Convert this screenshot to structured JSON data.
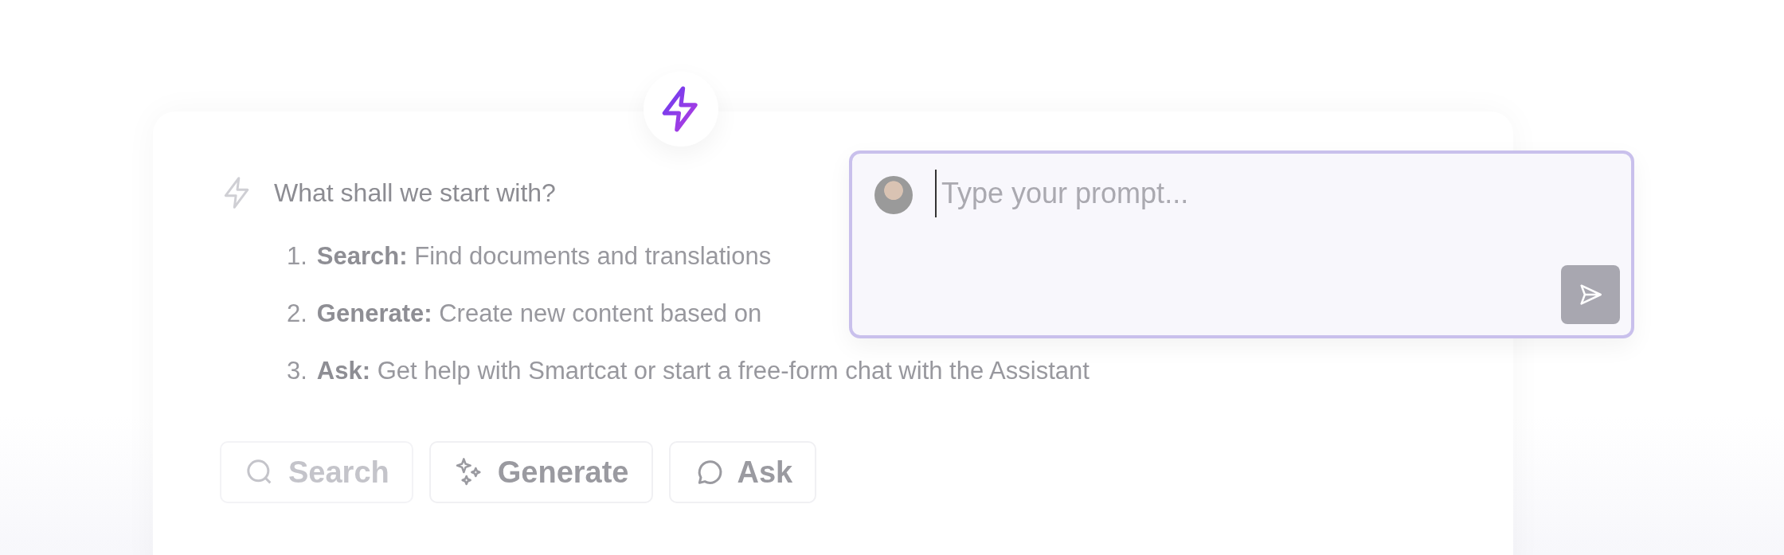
{
  "assistant": {
    "question": "What shall we start with?",
    "options": [
      {
        "number": "1.",
        "label": "Search:",
        "text": "Find documents and translations"
      },
      {
        "number": "2.",
        "label": "Generate:",
        "text": "Create new content based on"
      },
      {
        "number": "3.",
        "label": "Ask:",
        "text": "Get help with Smartcat or start a free-form chat with the Assistant"
      }
    ],
    "actions": [
      {
        "kind": "search",
        "label": "Search",
        "disabled": true
      },
      {
        "kind": "generate",
        "label": "Generate",
        "disabled": false
      },
      {
        "kind": "ask",
        "label": "Ask",
        "disabled": false
      }
    ]
  },
  "prompt": {
    "placeholder": "Type your prompt..."
  }
}
